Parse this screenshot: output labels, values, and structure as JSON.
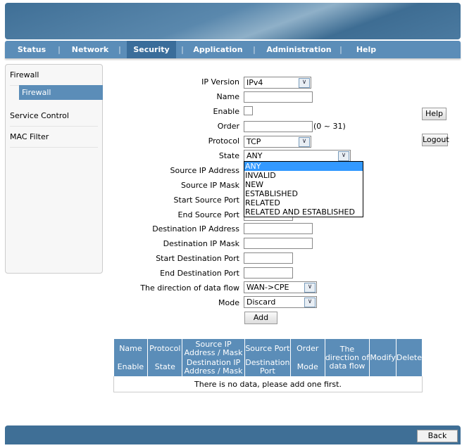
{
  "nav": {
    "items": [
      "Status",
      "Network",
      "Security",
      "Application",
      "Administration",
      "Help"
    ],
    "active": "Security"
  },
  "sidebar": {
    "items": [
      "Firewall",
      "Firewall",
      "Service Control",
      "MAC Filter"
    ]
  },
  "form": {
    "ip_version": {
      "label": "IP Version",
      "value": "IPv4"
    },
    "name": {
      "label": "Name",
      "value": ""
    },
    "enable": {
      "label": "Enable",
      "checked": false
    },
    "order": {
      "label": "Order",
      "value": "",
      "hint": "(0 ~ 31)"
    },
    "protocol": {
      "label": "Protocol",
      "value": "TCP"
    },
    "state": {
      "label": "State",
      "value": "ANY",
      "options": [
        "ANY",
        "INVALID",
        "NEW",
        "ESTABLISHED",
        "RELATED",
        "RELATED AND ESTABLISHED"
      ]
    },
    "src_ip": {
      "label": "Source IP Address"
    },
    "src_mask": {
      "label": "Source IP Mask"
    },
    "start_src_port": {
      "label": "Start Source Port"
    },
    "end_src_port": {
      "label": "End Source Port"
    },
    "dst_ip": {
      "label": "Destination IP Address"
    },
    "dst_mask": {
      "label": "Destination IP Mask"
    },
    "start_dst_port": {
      "label": "Start Destination Port"
    },
    "end_dst_port": {
      "label": "End Destination Port"
    },
    "direction": {
      "label": "The direction of data flow",
      "value": "WAN->CPE"
    },
    "mode": {
      "label": "Mode",
      "value": "Discard"
    },
    "add": "Add"
  },
  "help": "Help",
  "logout": "Logout",
  "table": {
    "h1": [
      "Name",
      "Protocol",
      "Source IP Address / Mask",
      "Source Port",
      "Order",
      "The direction of data flow",
      "Modify",
      "Delete"
    ],
    "h2": [
      "Enable",
      "State",
      "Destination IP Address / Mask",
      "Destination Port",
      "Mode"
    ],
    "empty": "There is no data, please add one first."
  },
  "back": "Back"
}
